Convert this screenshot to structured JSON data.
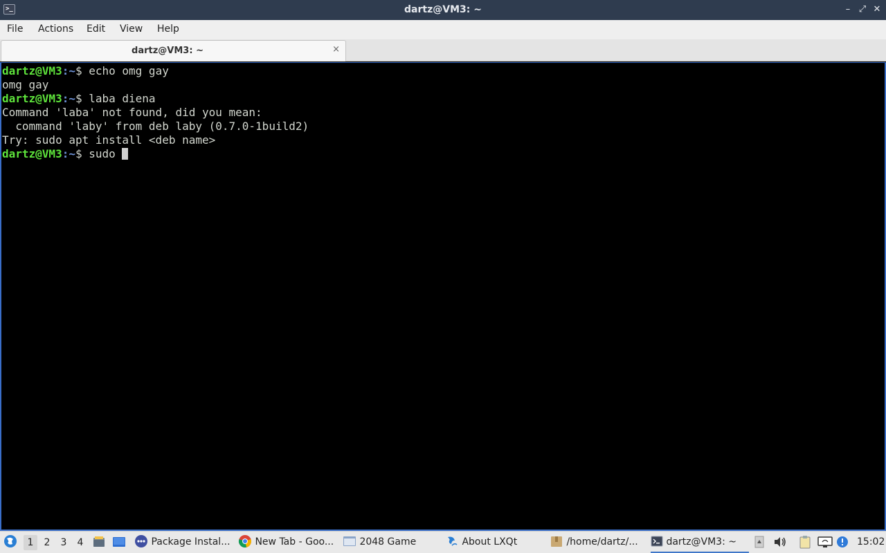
{
  "window": {
    "title": "dartz@VM3: ~",
    "controls": {
      "minimize": "–",
      "maximize": "⤢",
      "close": "✕"
    }
  },
  "menu": {
    "items": [
      "File",
      "Actions",
      "Edit",
      "View",
      "Help"
    ]
  },
  "tab": {
    "label": "dartz@VM3: ~",
    "close": "×"
  },
  "terminal": {
    "prompt_user": "dartz@VM3",
    "prompt_path": ":~",
    "prompt_symbol": "$ ",
    "lines": [
      {
        "kind": "prompt",
        "text": "echo omg gay"
      },
      {
        "kind": "output",
        "text": "omg gay"
      },
      {
        "kind": "prompt",
        "text": "laba diena"
      },
      {
        "kind": "output",
        "text": "Command 'laba' not found, did you mean:"
      },
      {
        "kind": "output",
        "text": "  command 'laby' from deb laby (0.7.0-1build2)"
      },
      {
        "kind": "output",
        "text": "Try: sudo apt install <deb name>"
      },
      {
        "kind": "prompt",
        "text": "sudo ",
        "cursor": true
      }
    ]
  },
  "taskbar": {
    "desktops": [
      "1",
      "2",
      "3",
      "4"
    ],
    "active_desktop": "1",
    "tasks": [
      {
        "label": "Package Instal...",
        "icon": "package-installer-icon"
      },
      {
        "label": "New Tab - Goo...",
        "icon": "chrome-icon"
      },
      {
        "label": "2048 Game",
        "icon": "window-icon"
      },
      {
        "label": "About LXQt",
        "icon": "lxqt-icon"
      },
      {
        "label": "/home/dartz/...",
        "icon": "folder-icon"
      },
      {
        "label": "dartz@VM3: ~",
        "icon": "terminal-icon",
        "active": true
      }
    ],
    "clock": "15:02"
  }
}
